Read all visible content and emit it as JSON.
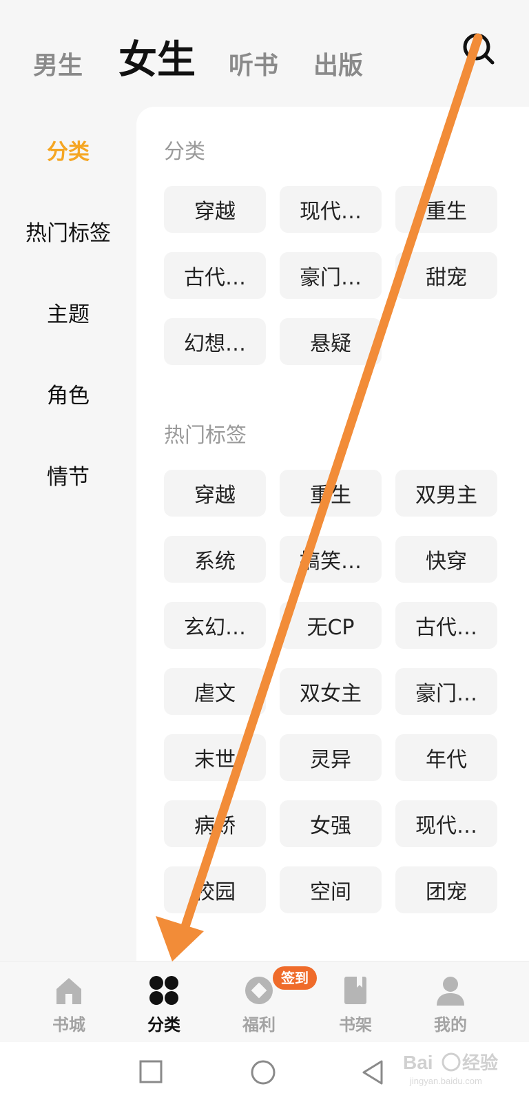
{
  "top_tabs": [
    {
      "label": "男生",
      "active": false
    },
    {
      "label": "女生",
      "active": true
    },
    {
      "label": "听书",
      "active": false
    },
    {
      "label": "出版",
      "active": false
    }
  ],
  "sidebar": {
    "items": [
      {
        "label": "分类",
        "active": true
      },
      {
        "label": "热门标签",
        "active": false
      },
      {
        "label": "主题",
        "active": false
      },
      {
        "label": "角色",
        "active": false
      },
      {
        "label": "情节",
        "active": false
      }
    ]
  },
  "sections": [
    {
      "title": "分类",
      "chips": [
        "穿越",
        "现代…",
        "重生",
        "古代…",
        "豪门…",
        "甜宠",
        "幻想…",
        "悬疑"
      ]
    },
    {
      "title": "热门标签",
      "chips": [
        "穿越",
        "重生",
        "双男主",
        "系统",
        "搞笑…",
        "快穿",
        "玄幻…",
        "无CP",
        "古代…",
        "虐文",
        "双女主",
        "豪门…",
        "末世",
        "灵异",
        "年代",
        "病娇",
        "女强",
        "现代…",
        "校园",
        "空间",
        "团宠"
      ]
    }
  ],
  "bottom_nav": {
    "items": [
      {
        "label": "书城",
        "icon": "home-icon",
        "active": false
      },
      {
        "label": "分类",
        "icon": "grid-icon",
        "active": true
      },
      {
        "label": "福利",
        "icon": "coin-icon",
        "active": false
      },
      {
        "label": "书架",
        "icon": "bookshelf-icon",
        "active": false
      },
      {
        "label": "我的",
        "icon": "profile-icon",
        "active": false
      }
    ],
    "badge": "签到"
  },
  "system_nav": [
    "square-icon",
    "circle-icon",
    "back-triangle-icon"
  ],
  "colors": {
    "accent": "#f5a623",
    "badge": "#ef6b2a",
    "arrow": "#f28c38"
  },
  "watermark": {
    "text": "Bai经验",
    "sub": "jingyan.baidu.com"
  }
}
